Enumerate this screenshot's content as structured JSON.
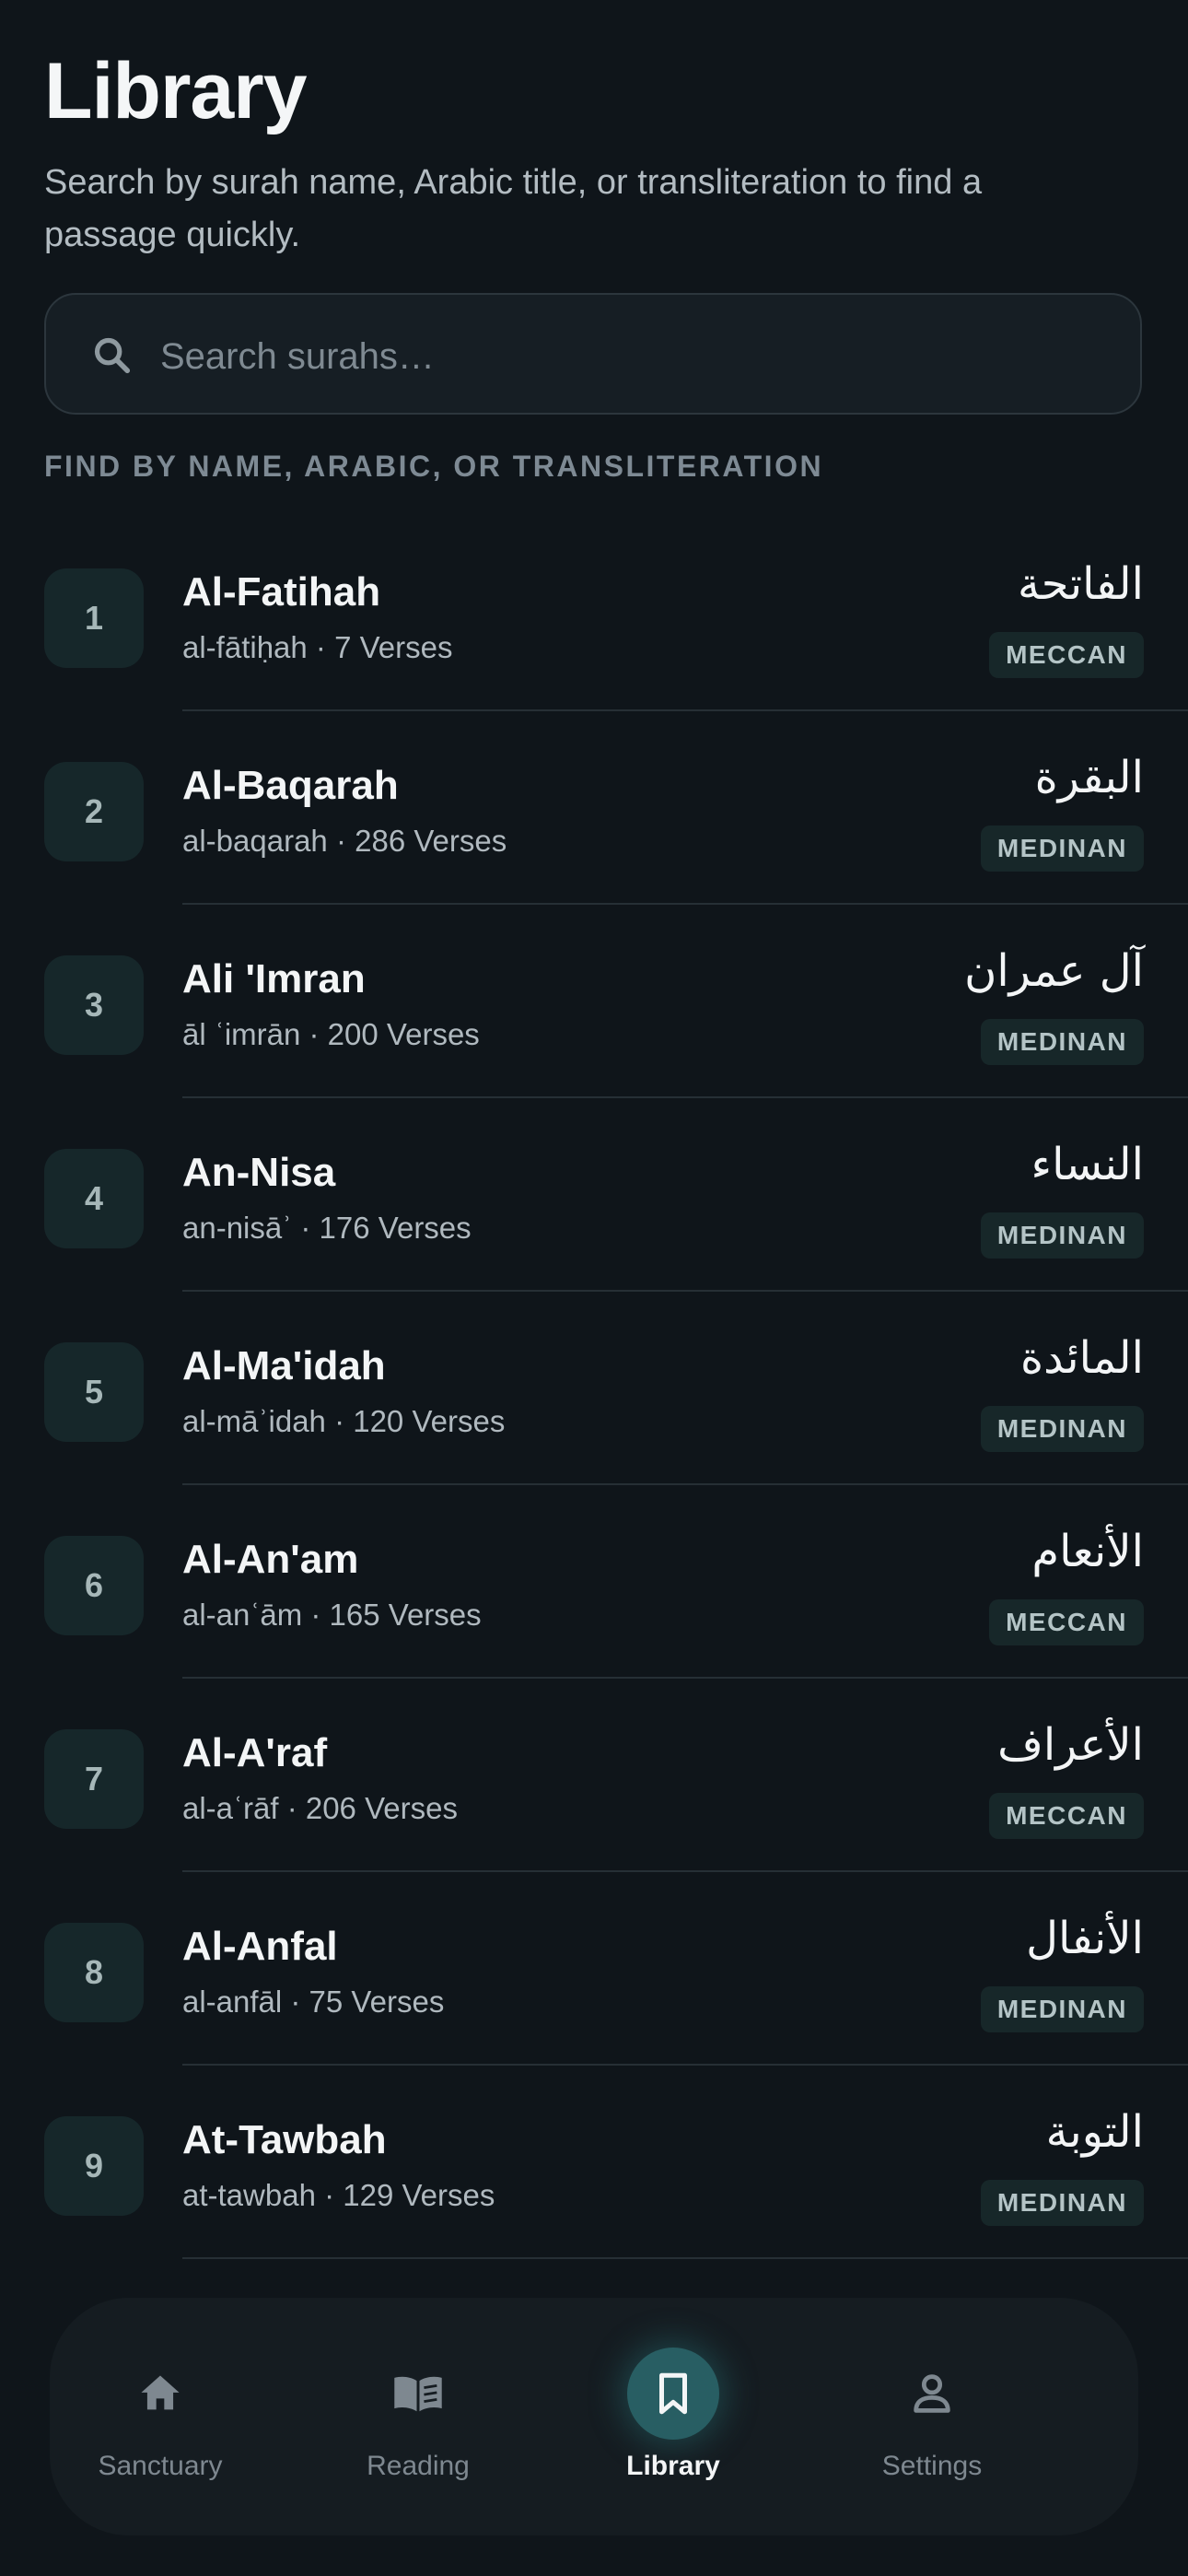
{
  "header": {
    "title": "Library",
    "subtitle": "Search by surah name, Arabic title, or transliteration to find a passage quickly."
  },
  "search": {
    "placeholder": "Search surahs…",
    "value": "",
    "icon": "search-icon"
  },
  "hint": "FIND BY NAME, ARABIC, OR TRANSLITERATION",
  "surahs": [
    {
      "number": "1",
      "name": "Al-Fatihah",
      "sub": "al-fātiḥah · 7 Verses",
      "arabic": "الفاتحة",
      "type": "MECCAN"
    },
    {
      "number": "2",
      "name": "Al-Baqarah",
      "sub": "al-baqarah · 286 Verses",
      "arabic": "البقرة",
      "type": "MEDINAN"
    },
    {
      "number": "3",
      "name": "Ali 'Imran",
      "sub": "āl ʿimrān · 200 Verses",
      "arabic": "آل عمران",
      "type": "MEDINAN"
    },
    {
      "number": "4",
      "name": "An-Nisa",
      "sub": "an-nisāʾ · 176 Verses",
      "arabic": "النساء",
      "type": "MEDINAN"
    },
    {
      "number": "5",
      "name": "Al-Ma'idah",
      "sub": "al-māʾidah · 120 Verses",
      "arabic": "المائدة",
      "type": "MEDINAN"
    },
    {
      "number": "6",
      "name": "Al-An'am",
      "sub": "al-anʿām · 165 Verses",
      "arabic": "الأنعام",
      "type": "MECCAN"
    },
    {
      "number": "7",
      "name": "Al-A'raf",
      "sub": "al-aʿrāf · 206 Verses",
      "arabic": "الأعراف",
      "type": "MECCAN"
    },
    {
      "number": "8",
      "name": "Al-Anfal",
      "sub": "al-anfāl · 75 Verses",
      "arabic": "الأنفال",
      "type": "MEDINAN"
    },
    {
      "number": "9",
      "name": "At-Tawbah",
      "sub": "at-tawbah · 129 Verses",
      "arabic": "التوبة",
      "type": "MEDINAN"
    }
  ],
  "nav": {
    "items": [
      {
        "label": "Sanctuary",
        "icon": "home-icon",
        "active": false
      },
      {
        "label": "Reading",
        "icon": "open-book-icon",
        "active": false
      },
      {
        "label": "Library",
        "icon": "bookmark-icon",
        "active": true
      },
      {
        "label": "Settings",
        "icon": "person-icon",
        "active": false
      }
    ]
  },
  "colors": {
    "background": "#0f151a",
    "accent": "#285e63",
    "badge_bg": "#172729"
  }
}
